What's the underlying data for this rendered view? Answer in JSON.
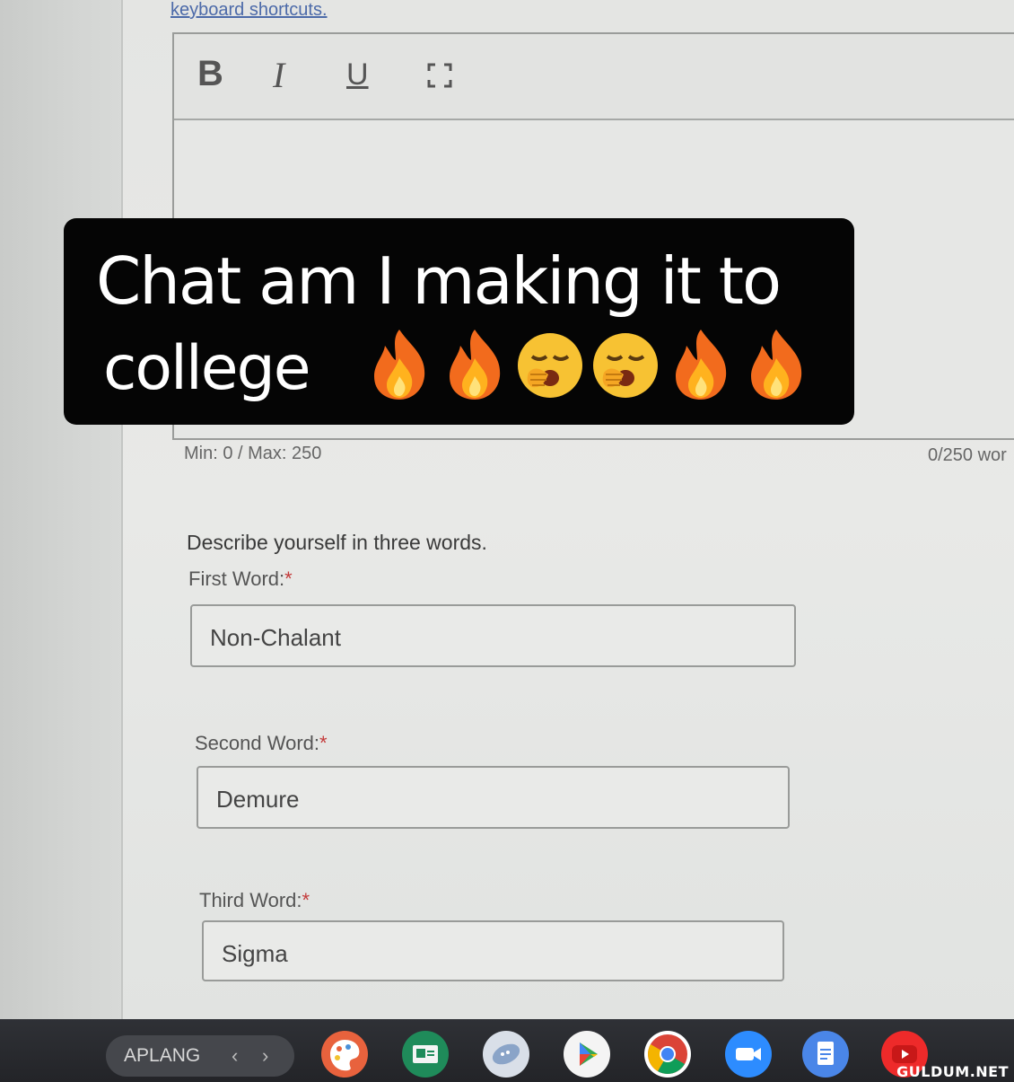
{
  "header": {
    "shortcuts_link": "keyboard shortcuts."
  },
  "toolbar": {
    "bold": "B",
    "italic": "I",
    "underline": "U"
  },
  "editor": {
    "min_max": "Min: 0 / Max: 250",
    "word_count": "0/250 wor"
  },
  "caption": {
    "line1": "Chat am I making it to",
    "line2": "college",
    "emojis": [
      "fire-icon",
      "fire-icon",
      "yawning-face-icon",
      "yawning-face-icon",
      "fire-icon",
      "fire-icon"
    ]
  },
  "form": {
    "question": "Describe yourself in three words.",
    "fields": [
      {
        "label": "First Word:",
        "required": "*",
        "value": "Non-Chalant"
      },
      {
        "label": "Second Word:",
        "required": "*",
        "value": "Demure"
      },
      {
        "label": "Third Word:",
        "required": "*",
        "value": "Sigma"
      }
    ]
  },
  "taskbar": {
    "tab_label": "APLANG",
    "back_arrow": "‹",
    "forward_arrow": "›",
    "apps": [
      "palette-icon",
      "classroom-icon",
      "chat-bubble-icon",
      "play-store-icon",
      "chrome-icon",
      "video-call-icon",
      "docs-icon",
      "youtube-icon"
    ]
  },
  "watermark": "GULDUM.NET",
  "colors": {
    "required": "#c43a3a",
    "link": "#4c6aa9",
    "caption_bg": "#050505"
  }
}
